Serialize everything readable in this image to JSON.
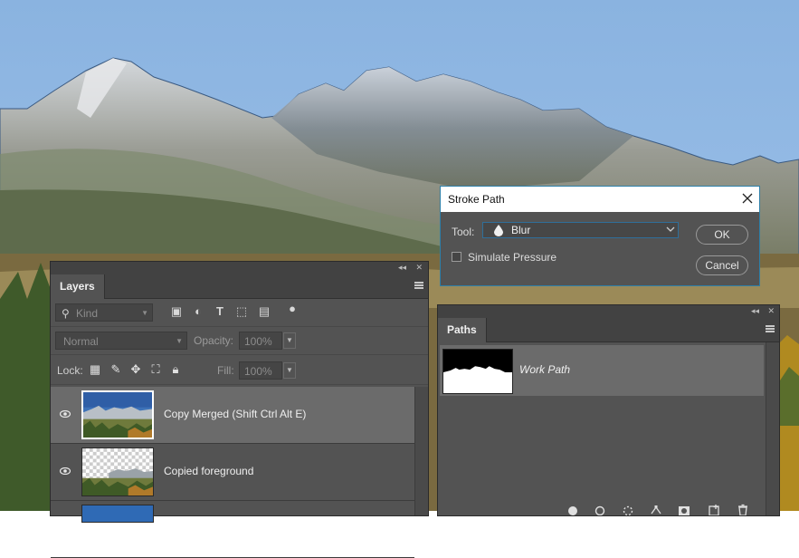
{
  "dialog": {
    "title": "Stroke Path",
    "tool_label": "Tool:",
    "tool_value": "Blur",
    "simulate_pressure_label": "Simulate Pressure",
    "simulate_pressure_checked": false,
    "ok_label": "OK",
    "cancel_label": "Cancel"
  },
  "layers_panel": {
    "tab_label": "Layers",
    "kind_placeholder": "Kind",
    "blend_mode": "Normal",
    "opacity_label": "Opacity:",
    "opacity_value": "100%",
    "lock_label": "Lock:",
    "fill_label": "Fill:",
    "fill_value": "100%",
    "layers": [
      {
        "name": "Copy Merged (Shift Ctrl Alt E)",
        "visible": true,
        "selected": true
      },
      {
        "name": "Copied foreground",
        "visible": true,
        "selected": false
      }
    ]
  },
  "paths_panel": {
    "tab_label": "Paths",
    "paths": [
      {
        "name": "Work Path",
        "selected": true
      }
    ]
  },
  "colors": {
    "panel_bg": "#535353",
    "selected_row": "#6b6b6b",
    "dialog_accent": "#2d7fa8"
  }
}
